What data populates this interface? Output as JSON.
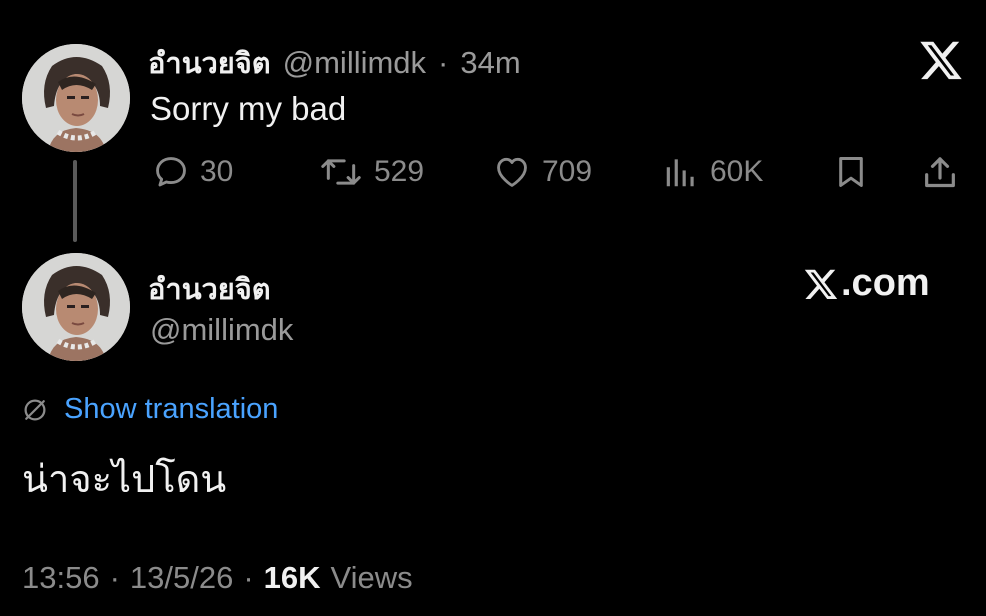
{
  "tweet": {
    "author_name": "อำนวยจิต",
    "author_handle": "@millimdk",
    "separator": "·",
    "time_ago": "34m",
    "text": "Sorry my bad",
    "actions": {
      "replies": "30",
      "reposts": "529",
      "likes": "709",
      "views": "60K"
    },
    "icons": {
      "reply": "reply-icon",
      "repost": "repost-icon",
      "like": "heart-icon",
      "views": "views-icon",
      "bookmark": "bookmark-icon",
      "share": "share-icon",
      "brand": "x-logo-icon"
    }
  },
  "quoted": {
    "author_name": "อำนวยจิต",
    "author_handle": "@millimdk",
    "site_label": ".com",
    "translate_label": "Show translation",
    "text": "น่าจะไปโดน",
    "footer": {
      "time": "13:56",
      "separator": "·",
      "date": "13/5/26",
      "views_count": "16K",
      "views_label": "Views"
    }
  },
  "colors": {
    "background": "#000000",
    "primary_text": "#f1f1f1",
    "secondary_text": "#8b8b8b",
    "link": "#4aa3ff",
    "thread_line": "#5a5a5a"
  }
}
